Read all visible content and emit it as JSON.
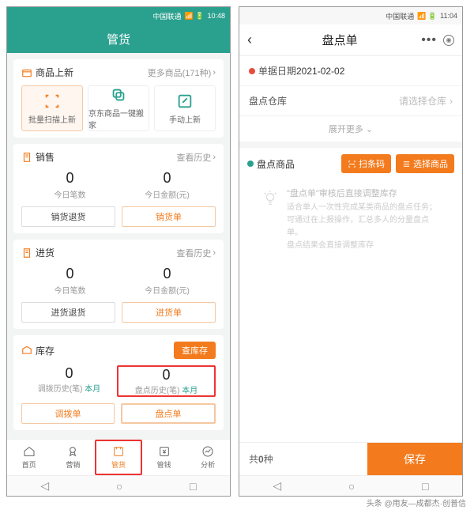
{
  "left": {
    "status": {
      "carrier": "中国联通",
      "icons": "📶 🔋",
      "time": "10:48"
    },
    "title": "管货",
    "newGoods": {
      "title": "商品上新",
      "more": "更多商品(171种)",
      "tiles": [
        {
          "label": "批量扫描上新"
        },
        {
          "label": "京东商品一键搬家"
        },
        {
          "label": "手动上新"
        }
      ]
    },
    "sales": {
      "title": "销售",
      "history": "查看历史",
      "stats": [
        {
          "num": "0",
          "lbl": "今日笔数"
        },
        {
          "num": "0",
          "lbl": "今日金额(元)"
        }
      ],
      "btns": [
        "销货退货",
        "销货单"
      ]
    },
    "purchase": {
      "title": "进货",
      "history": "查看历史",
      "stats": [
        {
          "num": "0",
          "lbl": "今日笔数"
        },
        {
          "num": "0",
          "lbl": "今日金额(元)"
        }
      ],
      "btns": [
        "进货退货",
        "进货单"
      ]
    },
    "stock": {
      "title": "库存",
      "btn": "查库存",
      "stats": [
        {
          "num": "0",
          "lbl": "调拨历史(笔)",
          "suffix": "本月"
        },
        {
          "num": "0",
          "lbl": "盘点历史(笔)",
          "suffix": "本月"
        }
      ],
      "btns": [
        "调拨单",
        "盘点单"
      ]
    },
    "tabs": [
      "首页",
      "营销",
      "管货",
      "管钱",
      "分析"
    ]
  },
  "right": {
    "status": {
      "carrier": "中国联通",
      "icons": "📶 🔋",
      "time": "11:04"
    },
    "title": "盘点单",
    "dateLabel": "单据日期",
    "dateValue": "2021-02-02",
    "whLabel": "盘点仓库",
    "whPlaceholder": "请选择仓库",
    "expand": "展开更多",
    "goodsLabel": "盘点商品",
    "scanBtn": "扫条码",
    "selectBtn": "选择商品",
    "tipTitle": "\"盘点单\"审核后直接调整库存",
    "tipLines": [
      "适合单人一次性完成某类商品的盘点任务；",
      "可通过在上报操作，汇总多人的分量盘点单。",
      "盘点结果会直接调整库存"
    ],
    "countPrefix": "共",
    "countNum": "0",
    "countSuffix": "种",
    "save": "保存"
  },
  "attribution": "头条 @用友—成都杰·创普信"
}
